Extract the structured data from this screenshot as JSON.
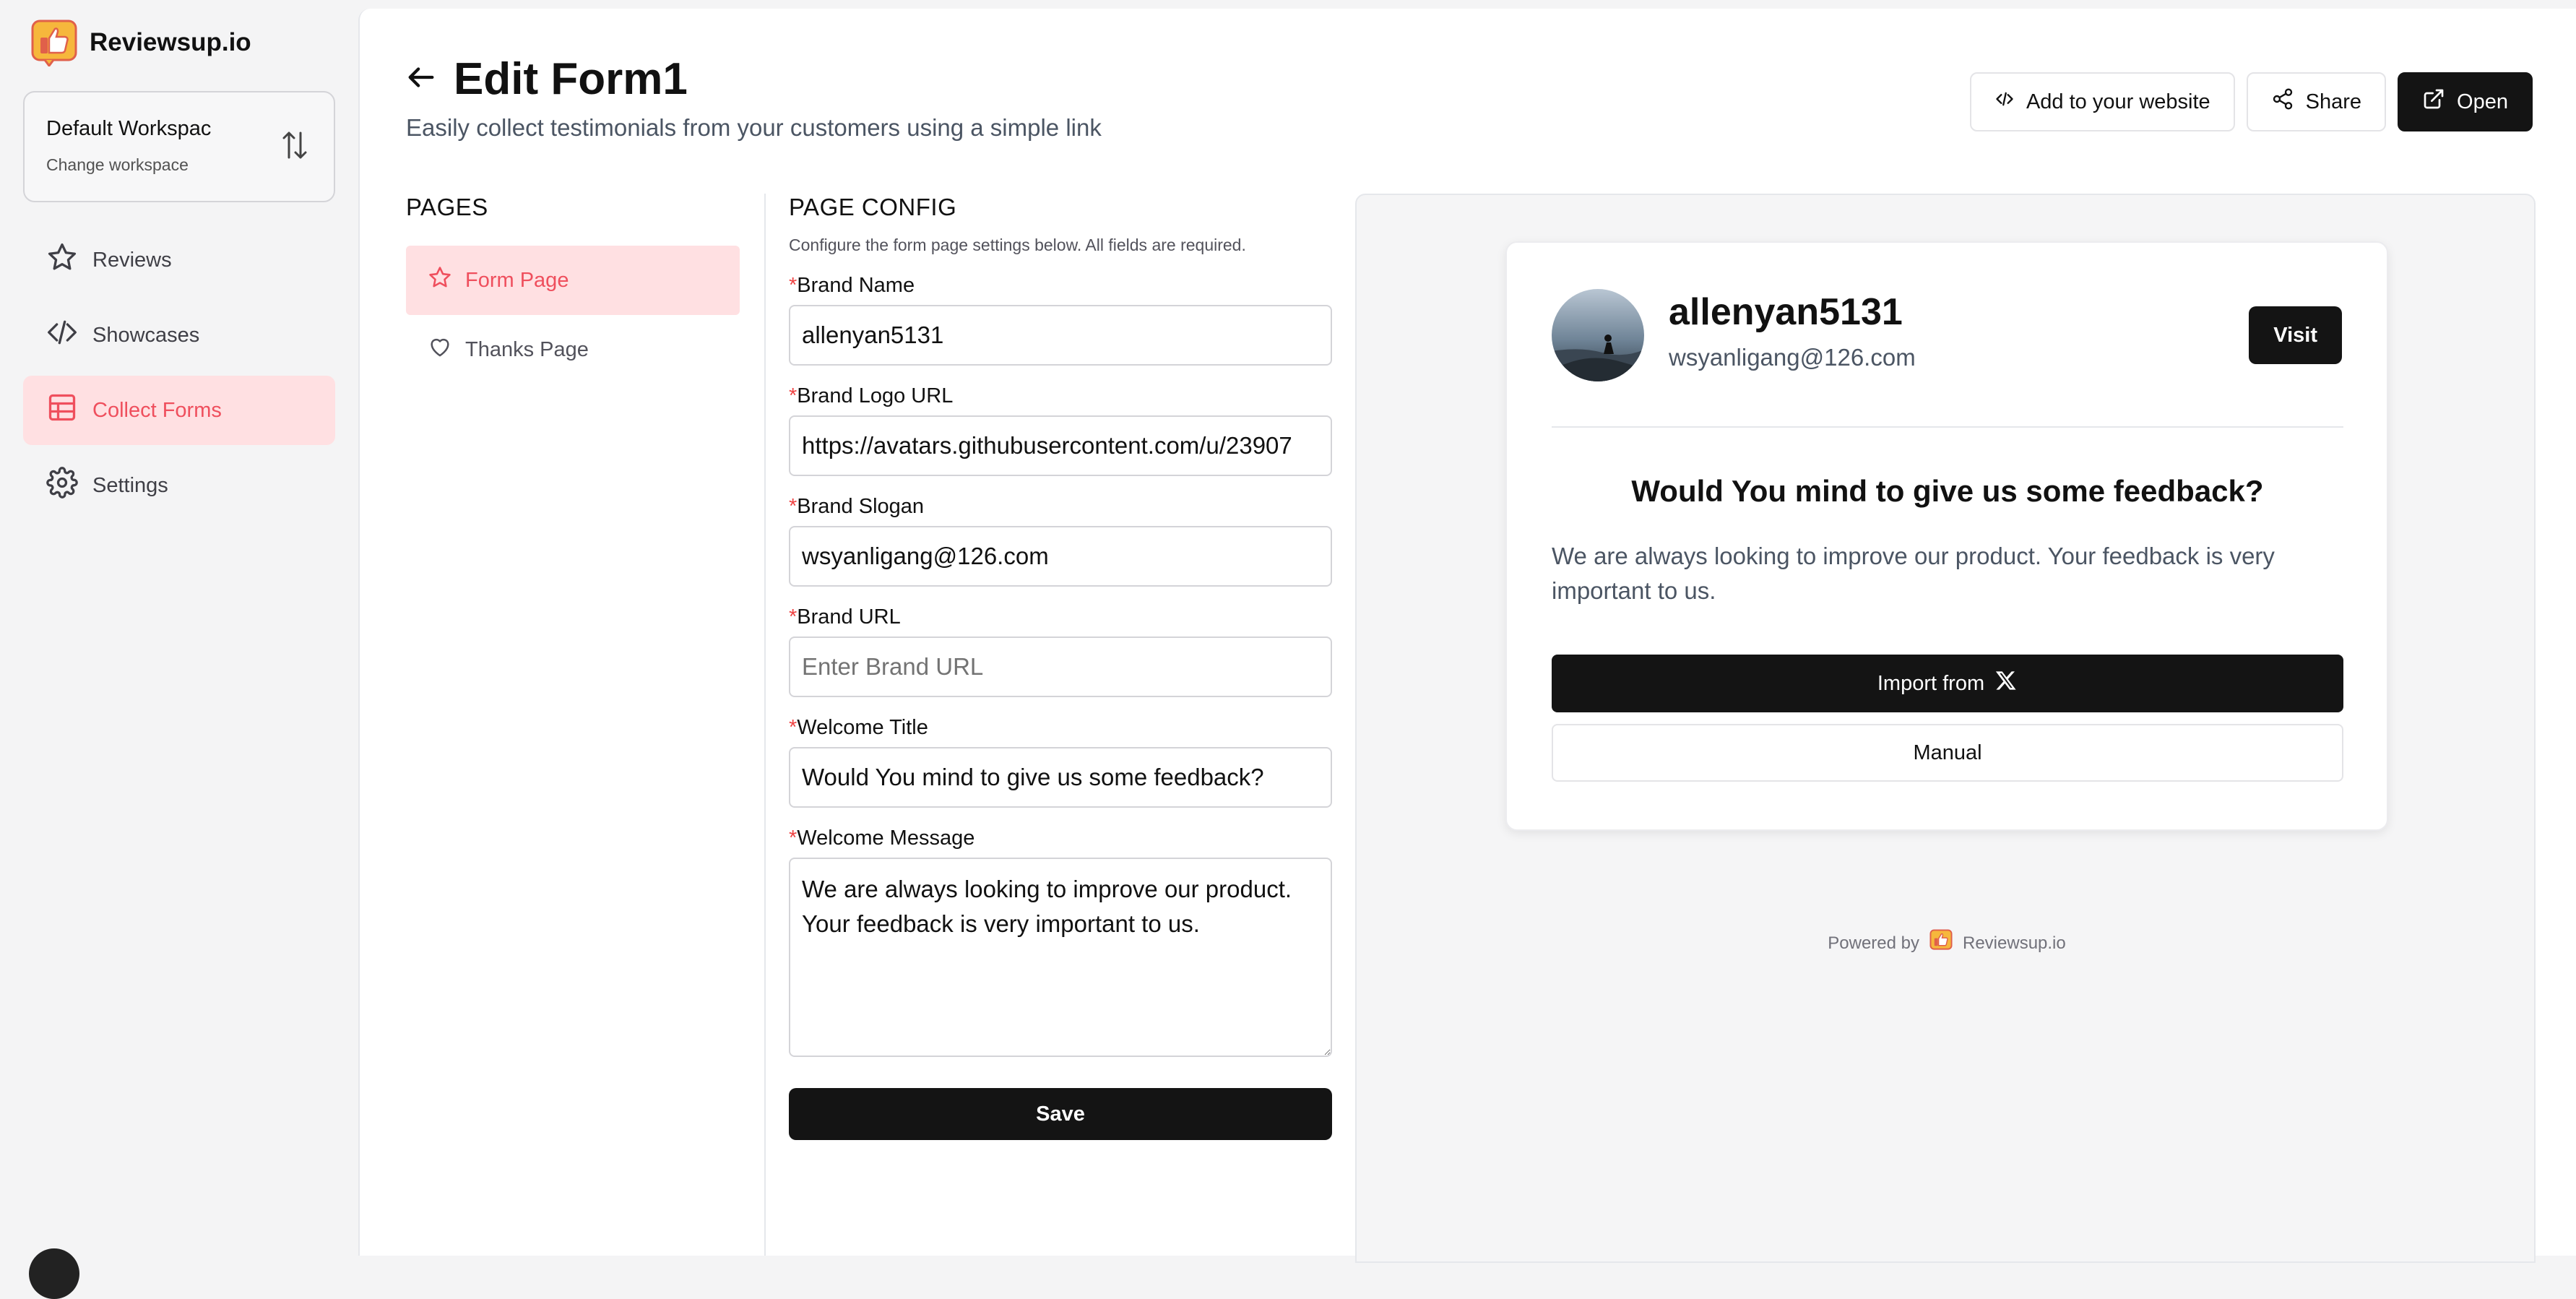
{
  "app": {
    "brand_name": "Reviewsup.io"
  },
  "workspace": {
    "name": "Default Workspac",
    "sub": "Change workspace"
  },
  "nav": {
    "items": [
      {
        "label": "Reviews",
        "icon": "star-icon"
      },
      {
        "label": "Showcases",
        "icon": "code-icon"
      },
      {
        "label": "Collect Forms",
        "icon": "table-icon",
        "active": true
      },
      {
        "label": "Settings",
        "icon": "gear-icon"
      }
    ]
  },
  "header": {
    "title": "Edit Form1",
    "subtitle": "Easily collect testimonials from your customers using a simple link",
    "add_to_website": "Add to your website",
    "share": "Share",
    "open": "Open"
  },
  "pages": {
    "title": "PAGES",
    "items": [
      {
        "label": "Form Page",
        "icon": "star-icon",
        "active": true
      },
      {
        "label": "Thanks Page",
        "icon": "heart-icon"
      }
    ]
  },
  "config": {
    "title": "PAGE CONFIG",
    "description": "Configure the form page settings below. All fields are required.",
    "required_mark": "*",
    "fields": {
      "brand_name": {
        "label": "Brand Name",
        "value": "allenyan5131"
      },
      "brand_logo_url": {
        "label": "Brand Logo URL",
        "value": "https://avatars.githubusercontent.com/u/23907"
      },
      "brand_slogan": {
        "label": "Brand Slogan",
        "value": "wsyanligang@126.com"
      },
      "brand_url": {
        "label": "Brand URL",
        "value": "",
        "placeholder": "Enter Brand URL"
      },
      "welcome_title": {
        "label": "Welcome Title",
        "value": "Would You mind to give us some feedback?"
      },
      "welcome_message": {
        "label": "Welcome Message",
        "value": "We are always looking to improve our product. Your feedback is very important to us."
      }
    },
    "save_label": "Save"
  },
  "preview": {
    "name": "allenyan5131",
    "email": "wsyanligang@126.com",
    "visit": "Visit",
    "title": "Would You mind to give us some feedback?",
    "message": "We are always looking to improve our product. Your feedback is very important to us.",
    "import_label": "Import from",
    "import_icon": "x-logo-icon",
    "manual_label": "Manual",
    "powered_by": "Powered by",
    "powered_brand": "Reviewsup.io"
  },
  "colors": {
    "accent": "#ef4f5d",
    "accent_bg": "#ffe0e2",
    "dark": "#141414"
  }
}
